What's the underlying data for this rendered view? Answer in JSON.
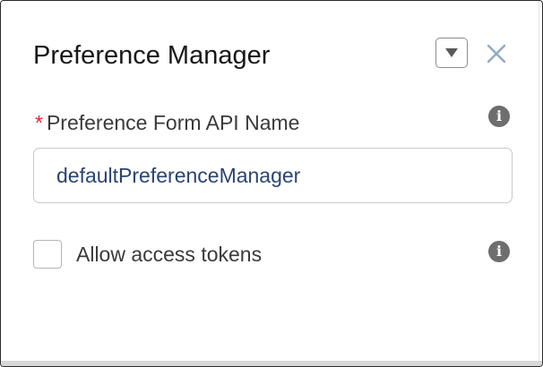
{
  "panel": {
    "title": "Preference Manager",
    "dropdown_icon": "chevron-down-icon",
    "close_icon": "close-icon"
  },
  "fields": {
    "api_name": {
      "required_marker": "*",
      "label": "Preference Form API Name",
      "value": "defaultPreferenceManager",
      "info_icon": "info-icon"
    },
    "allow_access_tokens": {
      "label": "Allow access tokens",
      "checked": false,
      "info_icon": "info-icon"
    }
  },
  "colors": {
    "title_text": "#181818",
    "label_text": "#3a3a3a",
    "required": "#e0242c",
    "input_value": "#2a4471",
    "close_icon": "#8fa9c6",
    "info_icon_bg": "#6e6e6e",
    "border": "#c9c9c9"
  },
  "info_glyph": "i"
}
